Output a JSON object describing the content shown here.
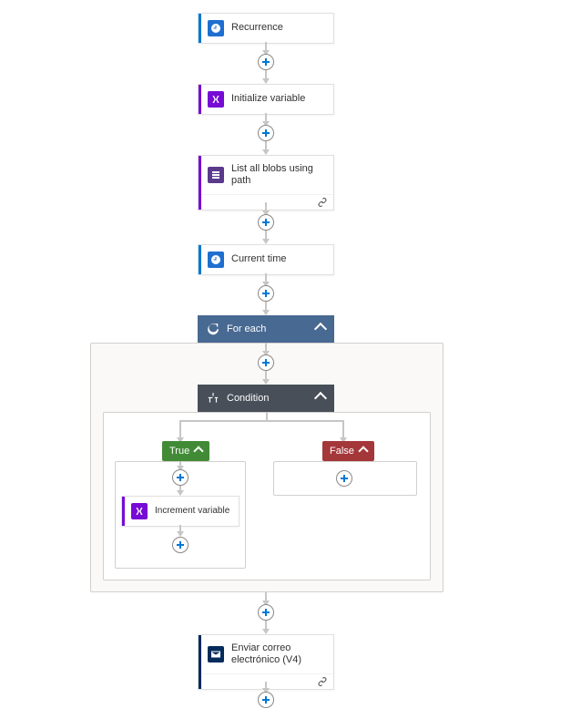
{
  "nodes": {
    "recurrence": {
      "title": "Recurrence",
      "accent": "#0078d4",
      "iconBg": "#1f6fd0"
    },
    "initVar": {
      "title": "Initialize variable",
      "accent": "#770bd6",
      "iconBg": "#770bd6"
    },
    "listBlobs": {
      "title": "List all blobs using path",
      "accent": "#770bd6",
      "iconBg": "#5b3a8e"
    },
    "currentTime": {
      "title": "Current time",
      "accent": "#0078d4",
      "iconBg": "#1f6fd0"
    },
    "foreach": {
      "title": "For each"
    },
    "condition": {
      "title": "Condition"
    },
    "trueBranch": {
      "title": "True"
    },
    "falseBranch": {
      "title": "False"
    },
    "incrementVar": {
      "title": "Increment variable",
      "accent": "#770bd6",
      "iconBg": "#770bd6"
    },
    "sendEmail": {
      "title": "Enviar correo electrónico (V4)",
      "accent": "#032B5B",
      "iconBg": "#032B5B"
    }
  },
  "chart_data": {
    "type": "flow-diagram",
    "title": "Logic App workflow designer",
    "nodes": [
      {
        "id": "recurrence",
        "label": "Recurrence",
        "kind": "trigger"
      },
      {
        "id": "initVar",
        "label": "Initialize variable",
        "kind": "action"
      },
      {
        "id": "listBlobs",
        "label": "List all blobs using path",
        "kind": "action"
      },
      {
        "id": "currentTime",
        "label": "Current time",
        "kind": "action"
      },
      {
        "id": "foreach",
        "label": "For each",
        "kind": "scope"
      },
      {
        "id": "condition",
        "label": "Condition",
        "kind": "scope",
        "parent": "foreach"
      },
      {
        "id": "trueBranch",
        "label": "True",
        "kind": "branch",
        "parent": "condition"
      },
      {
        "id": "incrementVar",
        "label": "Increment variable",
        "kind": "action",
        "parent": "trueBranch"
      },
      {
        "id": "falseBranch",
        "label": "False",
        "kind": "branch",
        "parent": "condition"
      },
      {
        "id": "sendEmail",
        "label": "Enviar correo electrónico (V4)",
        "kind": "action"
      }
    ],
    "edges": [
      [
        "recurrence",
        "initVar"
      ],
      [
        "initVar",
        "listBlobs"
      ],
      [
        "listBlobs",
        "currentTime"
      ],
      [
        "currentTime",
        "foreach"
      ],
      [
        "foreach",
        "condition"
      ],
      [
        "condition",
        "trueBranch"
      ],
      [
        "condition",
        "falseBranch"
      ],
      [
        "trueBranch",
        "incrementVar"
      ],
      [
        "foreach",
        "sendEmail"
      ]
    ]
  }
}
